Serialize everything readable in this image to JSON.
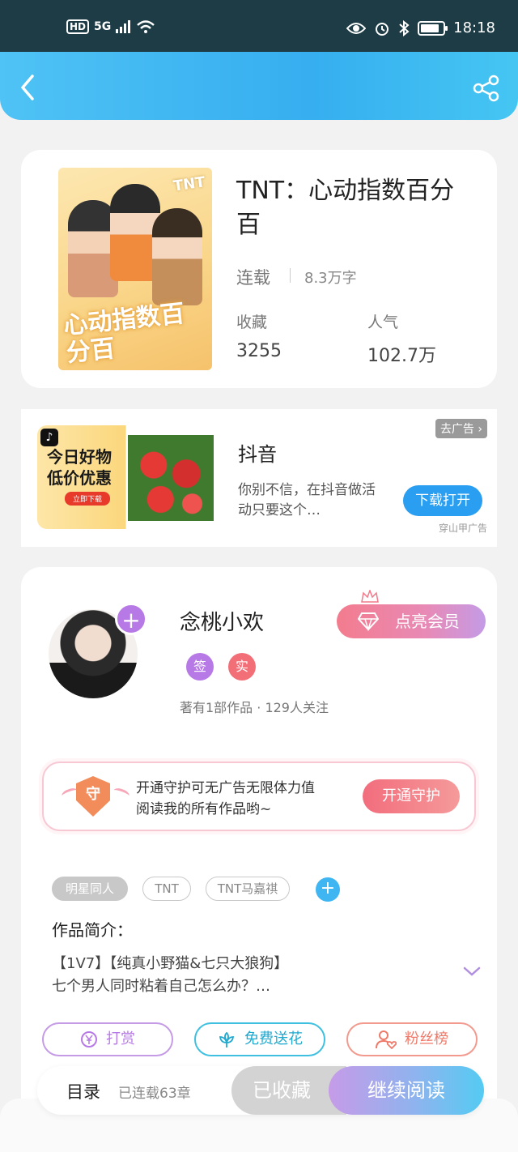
{
  "status_bar": {
    "hd": "HD",
    "network": "5G",
    "time": "18:18"
  },
  "book": {
    "title": "TNT：心动指数百分百",
    "status": "连载",
    "words": "8.3万字",
    "favorites_label": "收藏",
    "favorites_value": "3255",
    "popularity_label": "人气",
    "popularity_value": "102.7万",
    "cover": {
      "tag": "TNT",
      "title": "心动指数百分百"
    }
  },
  "ad": {
    "remove_label": "去广告",
    "image_text_line1": "今日好物",
    "image_text_line2": "低价优惠",
    "image_button": "立即下载",
    "title": "抖音",
    "description": "你别不信，在抖音做活动只要这个…",
    "button": "下载打开",
    "source": "穿山甲广告"
  },
  "author": {
    "name": "念桃小欢",
    "badge_sign": "签",
    "badge_real": "实",
    "meta": "著有1部作品 · 129人关注",
    "vip_button": "点亮会员",
    "guard_shield": "守",
    "guard_text_line1": "开通守护可无广告无限体力值",
    "guard_text_line2": "阅读我的所有作品哟~",
    "guard_button": "开通守护"
  },
  "tags": [
    "明星同人",
    "TNT",
    "TNT马嘉祺"
  ],
  "intro": {
    "label": "作品简介：",
    "line1": "【1V7】【纯真小野猫&七只大狼狗】",
    "line2": "七个男人同时粘着自己怎么办？…"
  },
  "actions": {
    "reward": "打赏",
    "flower": "免费送花",
    "fans": "粉丝榜"
  },
  "bottom": {
    "toc": "目录",
    "chapters": "已连载63章",
    "favorited": "已收藏",
    "continue": "继续阅读"
  },
  "colors": {
    "header": "#36aef0",
    "accent_purple": "#b779e6",
    "accent_pink": "#f26d7d"
  }
}
